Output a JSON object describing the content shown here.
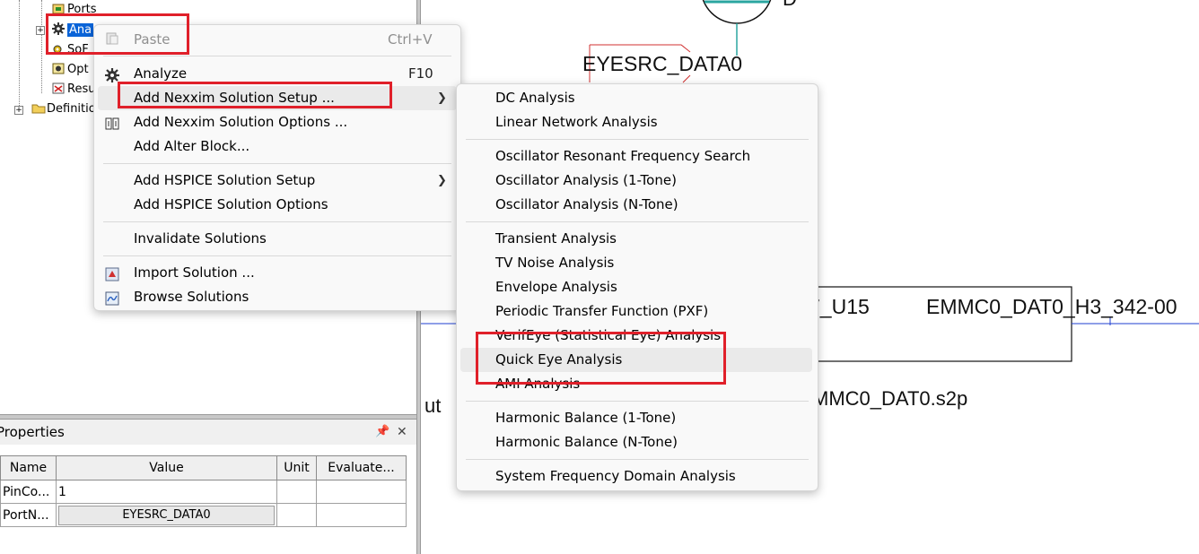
{
  "tree": {
    "items": [
      {
        "label": "Ports",
        "icon": "ports-icon"
      },
      {
        "label": "Ana",
        "icon": "gear-icon",
        "selected": true
      },
      {
        "label": "SoF",
        "icon": "gear-small-icon"
      },
      {
        "label": "Opt",
        "icon": "options-icon"
      },
      {
        "label": "Resu",
        "icon": "results-icon"
      },
      {
        "label": "Definitio",
        "icon": "folder-icon"
      }
    ]
  },
  "properties": {
    "title": "Properties",
    "pin_glyph": "📌",
    "close_glyph": "✕",
    "columns": [
      "Name",
      "Value",
      "Unit",
      "Evaluate..."
    ],
    "rows": [
      {
        "name": "PinCo...",
        "value": "1",
        "unit": "",
        "evaluated": ""
      },
      {
        "name": "PortN...",
        "value": "EYESRC_DATA0",
        "unit": "",
        "evaluated": ""
      }
    ]
  },
  "canvas": {
    "labels": {
      "port_name": "EYESRC_DATA0",
      "component_ref": "7_U15",
      "net_name": "EMMC0_DAT0_H3_342-00",
      "snp_file": "MMC0_DAT0.s2p",
      "partial_left": "ut",
      "top_fragment": "D"
    }
  },
  "context_menu": {
    "items": [
      {
        "label": "Paste",
        "shortcut": "Ctrl+V",
        "disabled": true,
        "icon": "paste-icon"
      },
      {
        "label": "Analyze",
        "shortcut": "F10",
        "icon": "analyze-icon"
      },
      {
        "label": "Add Nexxim Solution Setup ...",
        "submenu": true
      },
      {
        "label": "Add Nexxim Solution Options ...",
        "icon": "options-icon"
      },
      {
        "label": "Add Alter Block..."
      },
      {
        "label": "Add HSPICE Solution Setup",
        "submenu": true
      },
      {
        "label": "Add HSPICE Solution Options"
      },
      {
        "label": "Invalidate Solutions"
      },
      {
        "label": "Import Solution ...",
        "icon": "import-icon"
      },
      {
        "label": "Browse Solutions",
        "icon": "browse-icon"
      }
    ]
  },
  "submenu": {
    "items": [
      {
        "label": "DC Analysis"
      },
      {
        "label": "Linear Network Analysis"
      },
      {
        "label": "Oscillator Resonant Frequency Search"
      },
      {
        "label": "Oscillator Analysis (1-Tone)"
      },
      {
        "label": "Oscillator Analysis (N-Tone)"
      },
      {
        "label": "Transient Analysis"
      },
      {
        "label": "TV Noise Analysis"
      },
      {
        "label": "Envelope Analysis"
      },
      {
        "label": "Periodic Transfer Function (PXF)"
      },
      {
        "label": "VerifEye (Statistical Eye) Analysis"
      },
      {
        "label": "Quick Eye Analysis",
        "highlighted": true
      },
      {
        "label": "AMI Analysis"
      },
      {
        "label": "Harmonic Balance (1-Tone)"
      },
      {
        "label": "Harmonic Balance (N-Tone)"
      },
      {
        "label": "System Frequency Domain Analysis"
      }
    ]
  },
  "colors": {
    "selection": "#0a64d8",
    "annotation_red": "#e0202a",
    "wire_blue": "#1f3fd0",
    "wire_teal": "#2aa6a0"
  }
}
